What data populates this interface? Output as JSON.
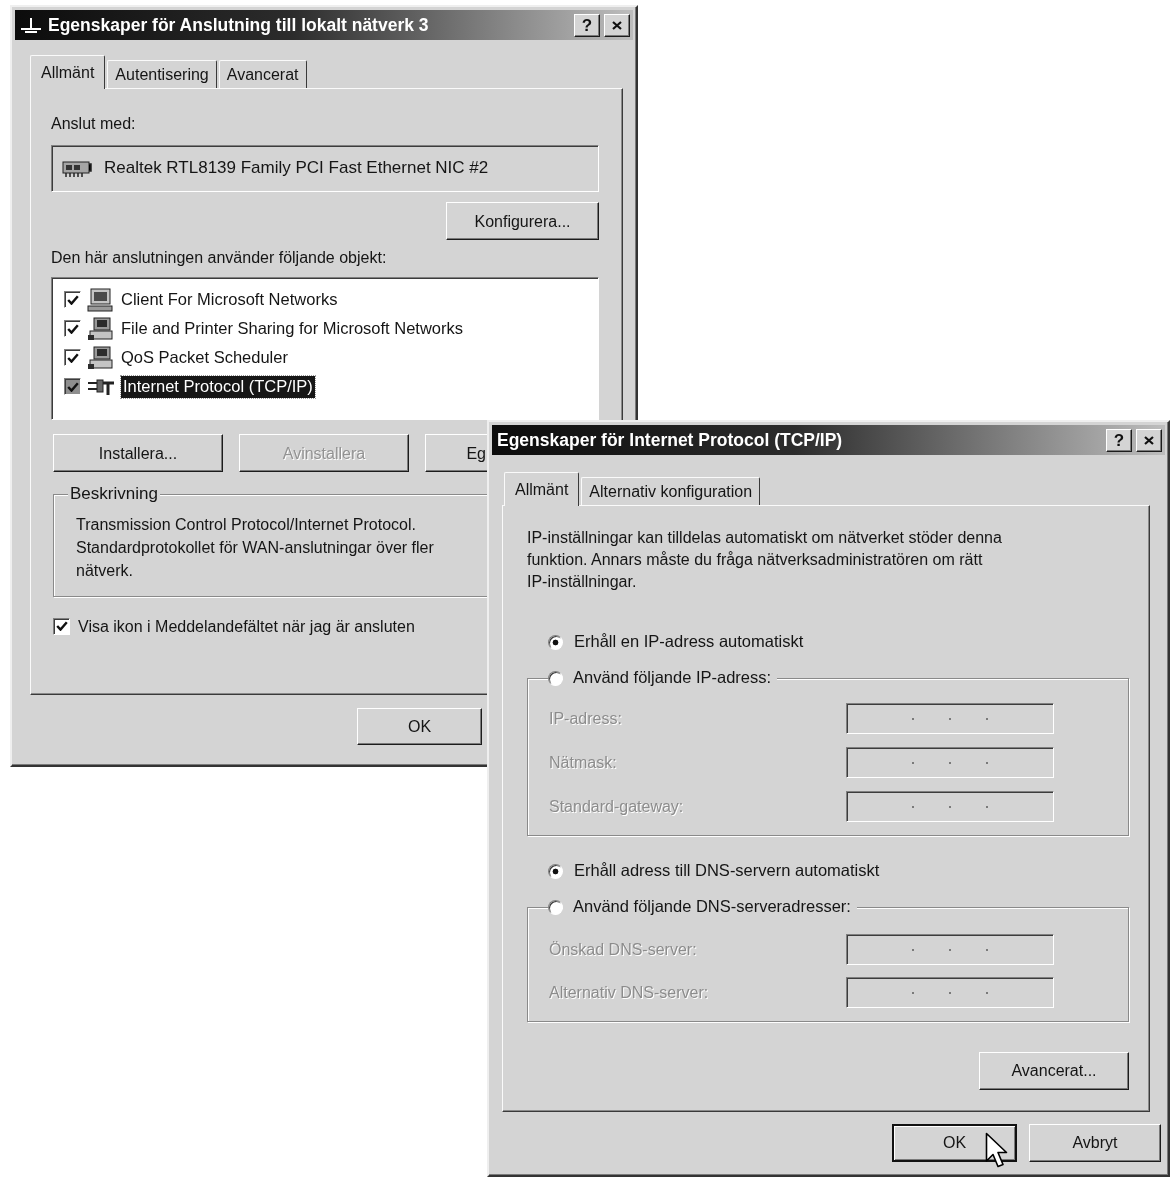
{
  "connection_window": {
    "title": "Egenskaper för Anslutning till lokalt nätverk 3",
    "help_button": "?",
    "tabs": [
      {
        "label": "Allmänt",
        "selected": true
      },
      {
        "label": "Autentisering",
        "selected": false
      },
      {
        "label": "Avancerat",
        "selected": false
      }
    ],
    "connect_using": {
      "label": "Anslut med:",
      "adapter": "Realtek RTL8139 Family PCI Fast Ethernet NIC #2"
    },
    "configure_button": "Konfigurera...",
    "components_label": "Den här anslutningen använder följande objekt:",
    "components": [
      {
        "kind": "client",
        "label": "Client For Microsoft Networks",
        "checked": true,
        "selected": false
      },
      {
        "kind": "service",
        "label": "File and Printer Sharing for Microsoft Networks",
        "checked": true,
        "selected": false
      },
      {
        "kind": "service",
        "label": "QoS Packet Scheduler",
        "checked": true,
        "selected": false
      },
      {
        "kind": "protocol",
        "label": "Internet Protocol (TCP/IP)",
        "checked": true,
        "selected": true
      }
    ],
    "buttons": [
      {
        "label": "Installera...",
        "disabled": false
      },
      {
        "label": "Avinstallera",
        "disabled": true
      },
      {
        "label": "Eg",
        "disabled": false
      }
    ],
    "description": {
      "legend": "Beskrivning",
      "text": "Transmission Control Protocol/Internet Protocol.\nStandardprotokollet för WAN-anslutningar över fler\nnätverk."
    },
    "show_icon": {
      "label": "Visa ikon i Meddelandefältet när jag är ansluten",
      "checked": true
    },
    "footer_buttons": [
      {
        "label": "OK",
        "default": false
      }
    ]
  },
  "tcpip_window": {
    "title": "Egenskaper för Internet Protocol (TCP/IP)",
    "help_button": "?",
    "tabs": [
      {
        "label": "Allmänt",
        "selected": true
      },
      {
        "label": "Alternativ konfiguration",
        "selected": false
      }
    ],
    "intro": "IP-inställningar kan tilldelas automatiskt om nätverket stöder denna\nfunktion. Annars måste du fråga nätverksadministratören om rätt\nIP-inställningar.",
    "sections": [
      {
        "auto_option": {
          "label": "Erhåll en IP-adress automatiskt",
          "selected": true
        },
        "manual_option": {
          "label": "Använd följande IP-adress:",
          "selected": false
        },
        "fields": [
          {
            "label": "IP-adress:",
            "disabled": true
          },
          {
            "label": "Nätmask:",
            "disabled": true
          },
          {
            "label": "Standard-gateway:",
            "disabled": true
          }
        ]
      },
      {
        "auto_option": {
          "label": "Erhåll adress till DNS-servern automatiskt",
          "selected": true
        },
        "manual_option": {
          "label": "Använd följande DNS-serveradresser:",
          "selected": false
        },
        "fields": [
          {
            "label": "Önskad DNS-server:",
            "disabled": true
          },
          {
            "label": "Alternativ DNS-server:",
            "disabled": true
          }
        ]
      }
    ],
    "advanced_button": "Avancerat...",
    "footer_buttons": [
      {
        "label": "OK",
        "default": true
      },
      {
        "label": "Avbryt",
        "default": false
      }
    ]
  }
}
